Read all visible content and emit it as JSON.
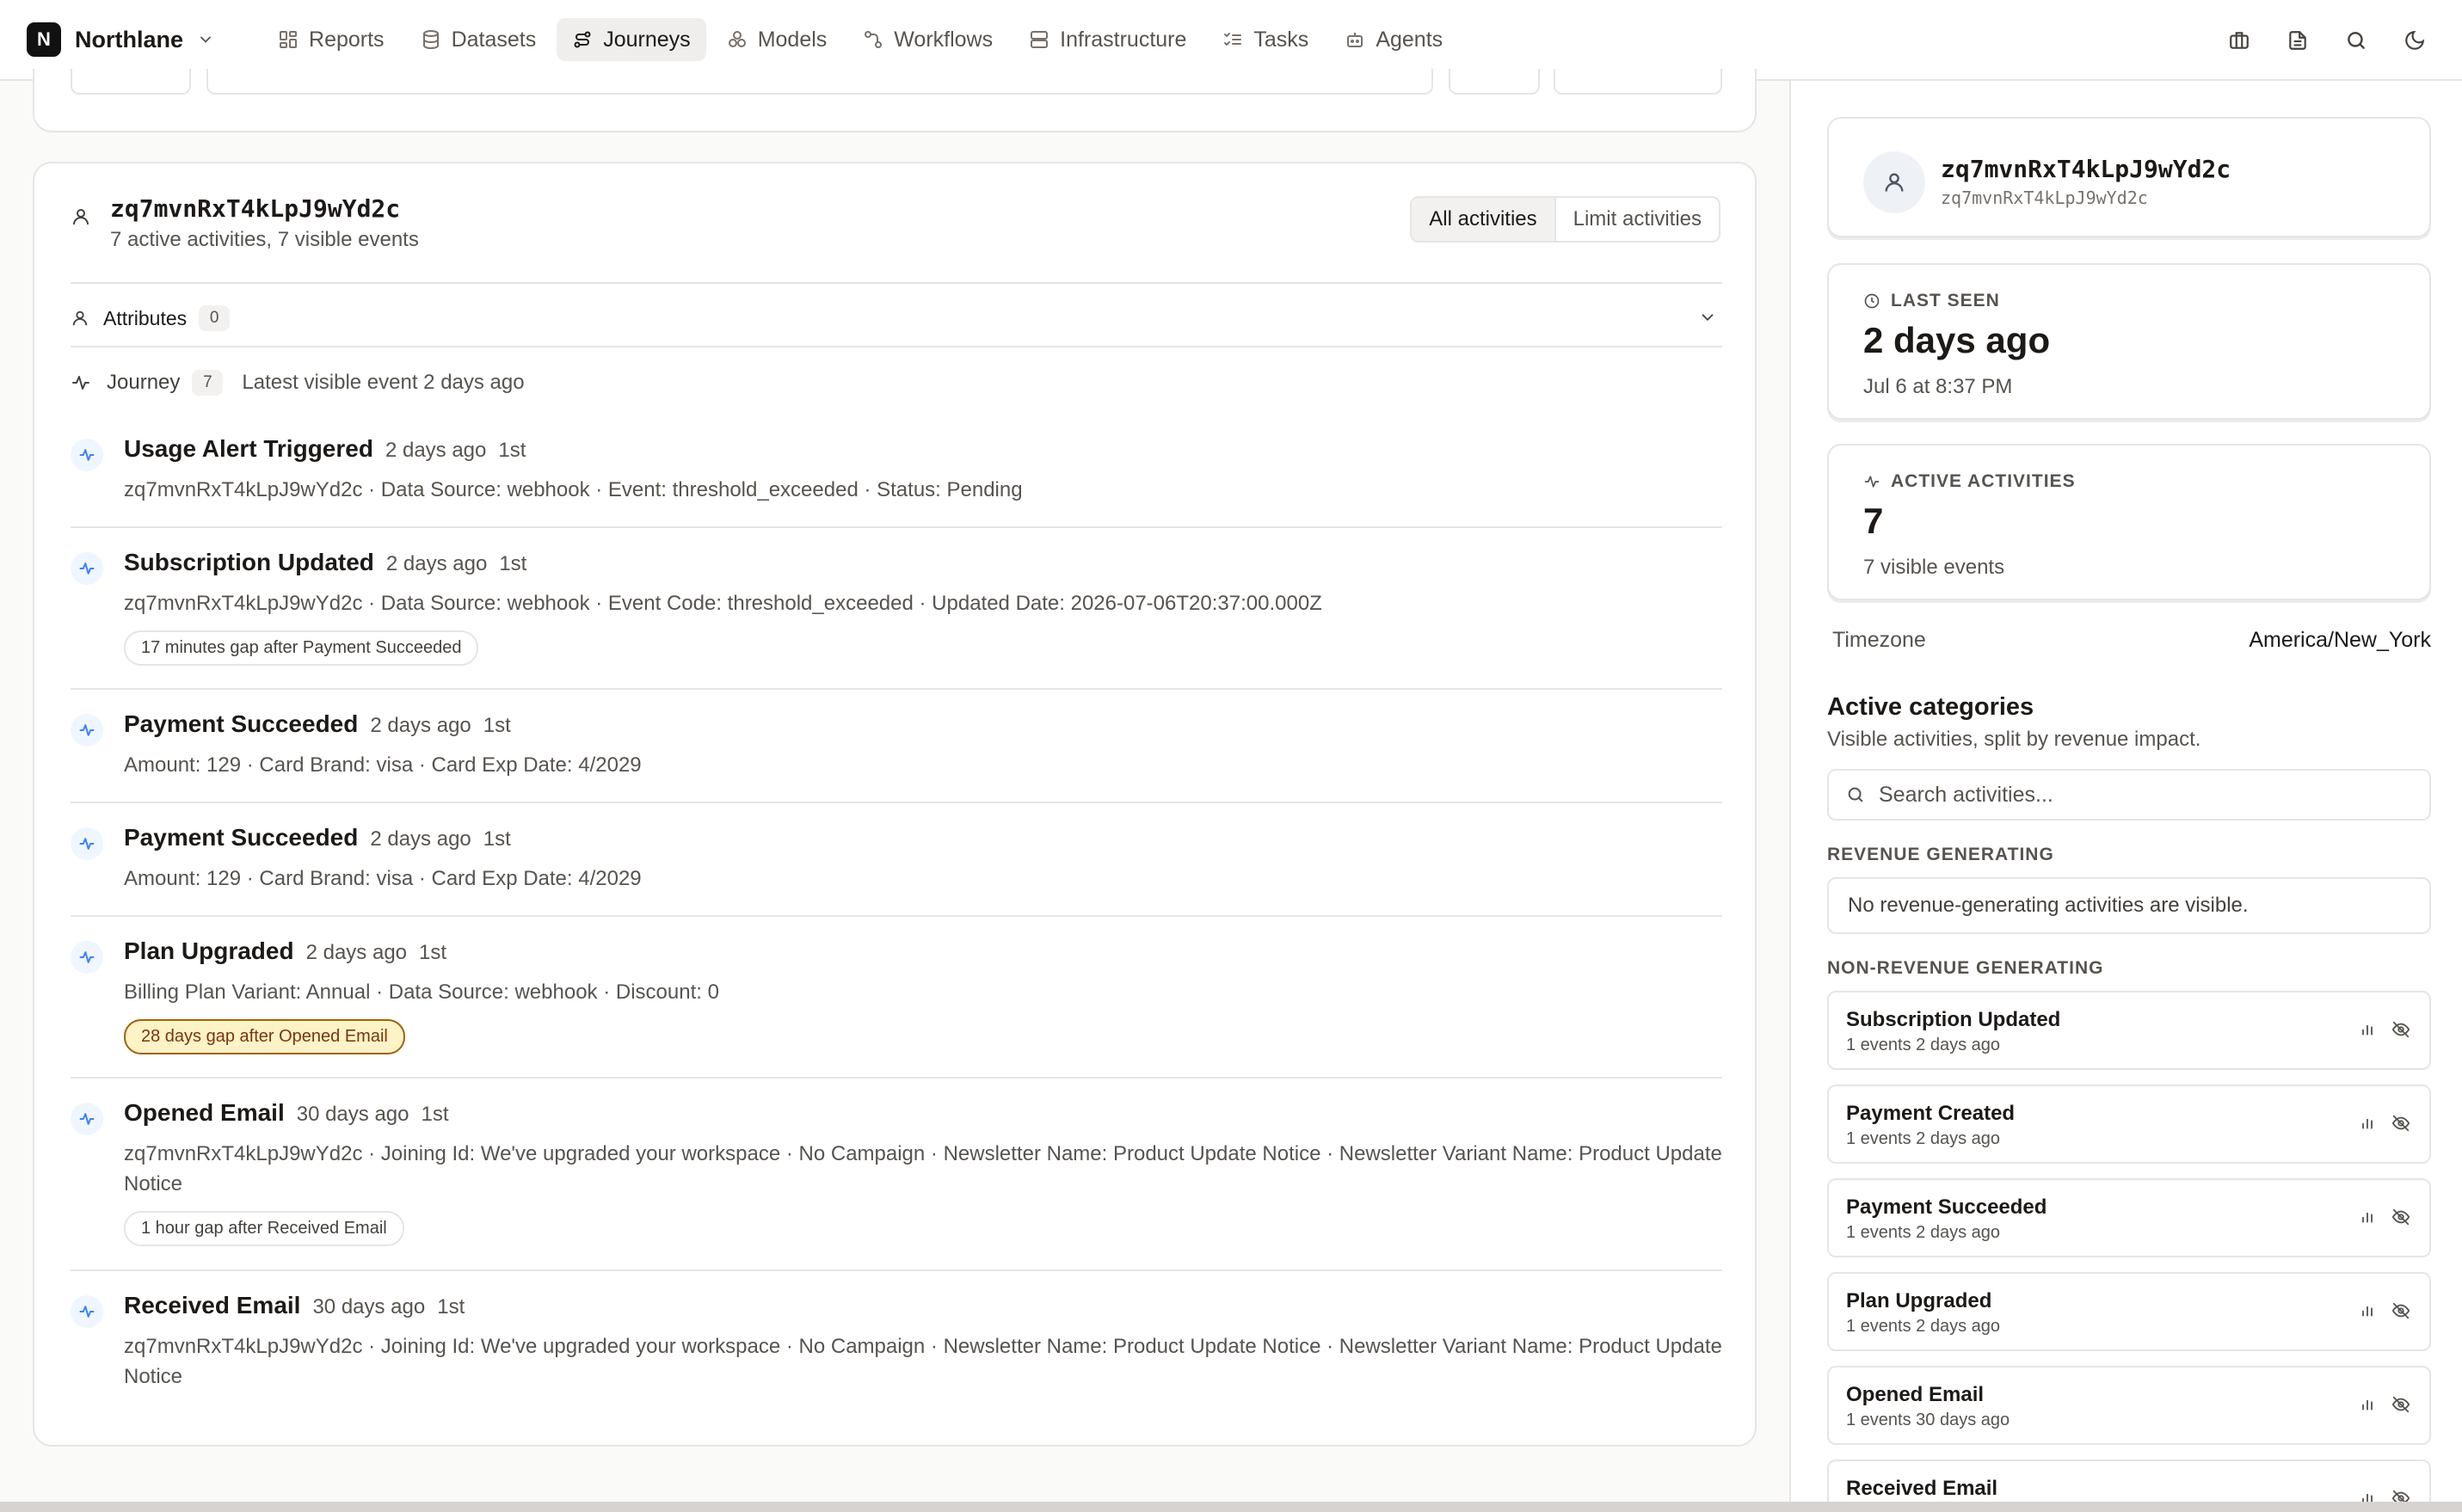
{
  "brand": {
    "letter": "N",
    "name": "Northlane"
  },
  "nav": [
    {
      "label": "Reports",
      "icon": "grid-icon",
      "active": false
    },
    {
      "label": "Datasets",
      "icon": "database-icon",
      "active": false
    },
    {
      "label": "Journeys",
      "icon": "route-icon",
      "active": true
    },
    {
      "label": "Models",
      "icon": "boxes-icon",
      "active": false
    },
    {
      "label": "Workflows",
      "icon": "workflow-icon",
      "active": false
    },
    {
      "label": "Infrastructure",
      "icon": "server-icon",
      "active": false
    },
    {
      "label": "Tasks",
      "icon": "list-checks-icon",
      "active": false
    },
    {
      "label": "Agents",
      "icon": "bot-icon",
      "active": false
    }
  ],
  "profile": {
    "id": "zq7mvnRxT4kLpJ9wYd2c",
    "summary": "7 active activities, 7 visible events"
  },
  "toggle": {
    "all": "All activities",
    "limit": "Limit activities"
  },
  "attributes": {
    "label": "Attributes",
    "count": "0"
  },
  "journey": {
    "label": "Journey",
    "count": "7",
    "latest": "Latest visible event 2 days ago"
  },
  "events": [
    {
      "title": "Usage Alert Triggered",
      "when": "2 days ago",
      "ord": "1st",
      "detail": "zq7mvnRxT4kLpJ9wYd2c · Data Source: webhook · Event: threshold_exceeded · Status: Pending",
      "gap": ""
    },
    {
      "title": "Subscription Updated",
      "when": "2 days ago",
      "ord": "1st",
      "detail": "zq7mvnRxT4kLpJ9wYd2c · Data Source: webhook · Event Code: threshold_exceeded · Updated Date: 2026-07-06T20:37:00.000Z",
      "gap": "17 minutes gap after Payment Succeeded"
    },
    {
      "title": "Payment Succeeded",
      "when": "2 days ago",
      "ord": "1st",
      "detail": "Amount: 129 · Card Brand: visa · Card Exp Date: 4/2029",
      "gap": ""
    },
    {
      "title": "Payment Succeeded",
      "when": "2 days ago",
      "ord": "1st",
      "detail": "Amount: 129 · Card Brand: visa · Card Exp Date: 4/2029",
      "gap": ""
    },
    {
      "title": "Plan Upgraded",
      "when": "2 days ago",
      "ord": "1st",
      "detail": "Billing Plan Variant: Annual · Data Source: webhook · Discount: 0",
      "gap": "28 days gap after Opened Email"
    },
    {
      "title": "Opened Email",
      "when": "30 days ago",
      "ord": "1st",
      "detail": "zq7mvnRxT4kLpJ9wYd2c · Joining Id: We've upgraded your workspace · No Campaign · Newsletter Name: Product Update Notice · Newsletter Variant Name: Product Update Notice",
      "gap": "1 hour gap after Received Email"
    },
    {
      "title": "Received Email",
      "when": "30 days ago",
      "ord": "1st",
      "detail": "zq7mvnRxT4kLpJ9wYd2c · Joining Id: We've upgraded your workspace · No Campaign · Newsletter Name: Product Update Notice · Newsletter Variant Name: Product Update Notice",
      "gap": ""
    }
  ],
  "sidebar": {
    "last_seen": {
      "label": "LAST SEEN",
      "value": "2 days ago",
      "sub": "Jul 6 at 8:37 PM"
    },
    "active": {
      "label": "ACTIVE ACTIVITIES",
      "value": "7",
      "sub": "7 visible events"
    },
    "timezone": {
      "label": "Timezone",
      "value": "America/New_York"
    },
    "categories": {
      "title": "Active categories",
      "subtitle": "Visible activities, split by revenue impact.",
      "search_placeholder": "Search activities...",
      "revenue_label": "REVENUE GENERATING",
      "revenue_empty": "No revenue-generating activities are visible.",
      "nonrevenue_label": "NON-REVENUE GENERATING",
      "items": [
        {
          "name": "Subscription Updated",
          "meta": "1 events 2 days ago"
        },
        {
          "name": "Payment Created",
          "meta": "1 events 2 days ago"
        },
        {
          "name": "Payment Succeeded",
          "meta": "1 events 2 days ago"
        },
        {
          "name": "Plan Upgraded",
          "meta": "1 events 2 days ago"
        },
        {
          "name": "Opened Email",
          "meta": "1 events 30 days ago"
        },
        {
          "name": "Received Email",
          "meta": ""
        }
      ]
    }
  },
  "colors": {
    "accent": "#3b82f6",
    "warn_bg": "#fef3c7",
    "warn_border": "#a16207"
  }
}
